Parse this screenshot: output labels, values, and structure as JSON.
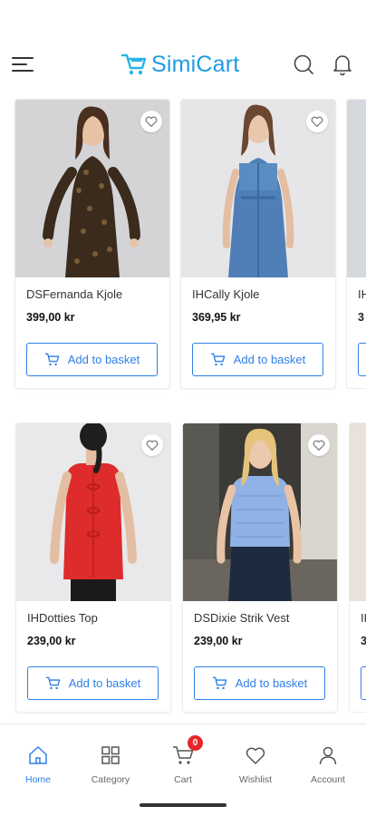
{
  "app": {
    "logo_text": "SimiCart",
    "brand_color": "#1f9be0",
    "accent_color": "#2f7fe8"
  },
  "header": {
    "menu_icon": "hamburger-menu-icon",
    "search_icon": "search-icon",
    "notifications_icon": "bell-icon"
  },
  "products": [
    {
      "name": "DSFernanda Kjole",
      "price": "399,00 kr",
      "button": "Add to basket"
    },
    {
      "name": "IHCally Kjole",
      "price": "369,95 kr",
      "button": "Add to basket"
    },
    {
      "name": "IHDotties Top",
      "price": "239,00 kr",
      "button": "Add to basket"
    },
    {
      "name": "DSDixie Strik Vest",
      "price": "239,00 kr",
      "button": "Add to basket"
    }
  ],
  "partial_products": [
    {
      "name": "IH",
      "price": "3"
    },
    {
      "name": "IH",
      "price": "3"
    }
  ],
  "nav": {
    "items": [
      {
        "label": "Home",
        "icon": "home-icon",
        "active": true
      },
      {
        "label": "Category",
        "icon": "grid-icon"
      },
      {
        "label": "Cart",
        "icon": "cart-icon",
        "badge": "0"
      },
      {
        "label": "Wishlist",
        "icon": "heart-icon"
      },
      {
        "label": "Account",
        "icon": "user-icon"
      }
    ]
  }
}
